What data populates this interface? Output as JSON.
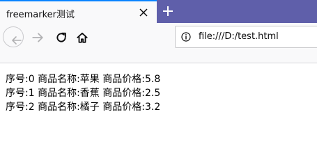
{
  "tab": {
    "title": "freemarker测试",
    "close_icon": "close-icon"
  },
  "new_tab_icon": "plus-icon",
  "toolbar": {
    "back_icon": "arrow-left-icon",
    "forward_icon": "arrow-right-icon",
    "reload_icon": "reload-icon",
    "home_icon": "home-icon"
  },
  "urlbar": {
    "info_icon": "info-icon",
    "url": "file:///D:/test.html"
  },
  "content": {
    "lines": [
      "序号:0 商品名称:苹果 商品价格:5.8",
      "序号:1 商品名称:香蕉 商品价格:2.5",
      "序号:2 商品名称:橘子 商品价格:3.2"
    ]
  },
  "colors": {
    "tabstrip": "#5f5faa",
    "tab_accent": "#0a84ff",
    "toolbar": "#f9f9fa"
  }
}
